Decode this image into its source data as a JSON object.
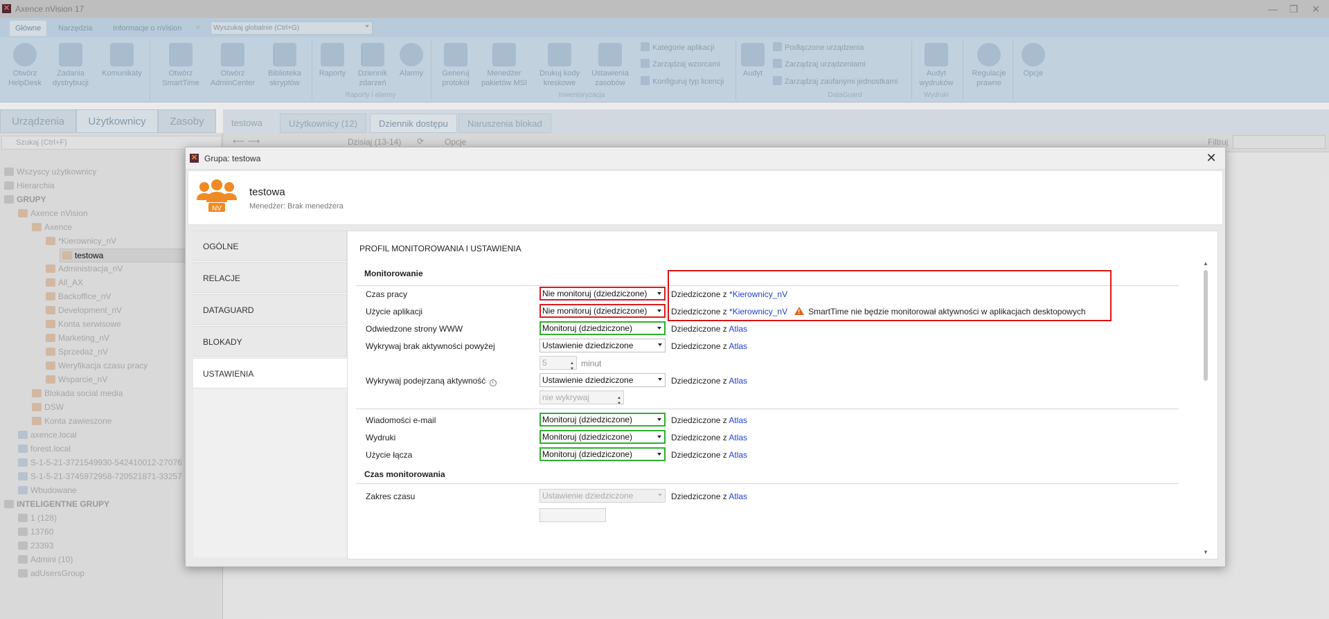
{
  "app": {
    "title": "Axence nVision 17",
    "menu_tabs": [
      "Główne",
      "Narzędzia",
      "Informacje o nVision"
    ],
    "global_search_placeholder": "Wyszukaj globalnie (Ctrl+G)"
  },
  "ribbon": {
    "buttons": [
      {
        "label": "Otwórz HelpDesk",
        "icon": "helpdesk-icon"
      },
      {
        "label": "Zadania dystrybucji",
        "icon": "distribution-icon"
      },
      {
        "label": "Komunikaty",
        "icon": "megaphone-icon"
      },
      {
        "label": "Otwórz SmartTime",
        "icon": "smarttime-icon"
      },
      {
        "label": "Otwórz AdminCenter",
        "icon": "admincenter-icon"
      },
      {
        "label": "Biblioteka skryptów",
        "icon": "script-library-icon"
      },
      {
        "label": "Raporty",
        "icon": "reports-icon"
      },
      {
        "label": "Dziennik zdarzeń",
        "icon": "event-log-icon"
      },
      {
        "label": "Alarmy",
        "icon": "alarm-icon"
      },
      {
        "label": "Generuj protokół",
        "icon": "protocol-icon"
      },
      {
        "label": "Menedżer pakietów MSI",
        "icon": "msi-icon"
      },
      {
        "label": "Drukuj kody kreskowe",
        "icon": "barcode-printer-icon"
      },
      {
        "label": "Ustawienia zasobów",
        "icon": "assets-settings-icon"
      },
      {
        "label": "Audyt",
        "icon": "audit-icon"
      },
      {
        "label": "Audyt wydruków",
        "icon": "print-audit-icon"
      },
      {
        "label": "Regulacje prawne",
        "icon": "legal-icon"
      },
      {
        "label": "Opcje",
        "icon": "gear-icon"
      }
    ],
    "small_buttons": [
      "Kategorie aplikacji",
      "Zarządzaj wzorcami",
      "Konfiguruj typ licencji",
      "Podłączone urządzenia",
      "Zarządzaj urządzeniami",
      "Zarządzaj zaufanymi jednostkami"
    ],
    "group_labels": [
      "Raporty i alarmy",
      "Inwentaryzacja",
      "DataGuard",
      "Wydruki"
    ]
  },
  "left_tabs": [
    "Urządzenia",
    "Użytkownicy",
    "Zasoby"
  ],
  "left_search_placeholder": "Szukaj (Ctrl+F)",
  "tree": [
    "Wszyscy użytkownicy",
    "Hierarchia",
    "GRUPY",
    "Axence nVision",
    "Axence",
    "*Kierownicy_nV",
    "testowa",
    "Administracja_nV",
    "All_AX",
    "Backoffice_nV",
    "Development_nV",
    "Konta serwisowe",
    "Marketing_nV",
    "Sprzedaż_nV",
    "Weryfikacja czasu pracy",
    "Wsparcie_nV",
    "Blokada social media",
    "DSW",
    "Konta zawieszone",
    "axence.local",
    "forest.local",
    "S-1-5-21-3721549930-542410012-27076",
    "S-1-5-21-3745972958-720521871-33257",
    "Wbudowane",
    "INTELIGENTNE GRUPY",
    "1 (128)",
    "13760",
    "23393",
    "Admini (10)",
    "adUsersGroup"
  ],
  "right_tabs": [
    "testowa",
    "Użytkownicy (12)",
    "Dziennik dostępu",
    "Naruszenia blokad"
  ],
  "toolbar": {
    "date": "Dzisiaj (13-14)",
    "options": "Opcje",
    "filter": "Filtruj"
  },
  "dialog": {
    "title": "Grupa: testowa",
    "group_name": "testowa",
    "avatar_badge": "NV",
    "manager": "Menedżer:  Brak menedżera",
    "nav": [
      "OGÓLNE",
      "RELACJE",
      "DATAGUARD",
      "BLOKADY",
      "USTAWIENIA"
    ],
    "section_title": "PROFIL MONITOROWANIA I USTAWIENIA",
    "monitoring_header": "Monitorowanie",
    "time_header": "Czas monitorowania",
    "rows": [
      {
        "label": "Czas pracy",
        "value": "Nie monitoruj (dziedziczone)",
        "inherited_prefix": "Dziedziczone z",
        "source": "*Kierownicy_nV"
      },
      {
        "label": "Użycie aplikacji",
        "value": "Nie monitoruj (dziedziczone)",
        "inherited_prefix": "Dziedziczone z",
        "source": "*Kierownicy_nV",
        "warning": "SmartTime nie będzie monitorował aktywności w aplikacjach desktopowych"
      },
      {
        "label": "Odwiedzone strony WWW",
        "value": "Monitoruj (dziedziczone)",
        "inherited_prefix": "Dziedziczone z",
        "source": "Atlas"
      },
      {
        "label": "Wykrywaj brak aktywności powyżej",
        "value": "Ustawienie dziedziczone",
        "inherited_prefix": "Dziedziczone z",
        "source": "Atlas"
      },
      {
        "label": "Wykrywaj podejrzaną aktywność",
        "value": "Ustawienie dziedziczone",
        "inherited_prefix": "Dziedziczone z",
        "source": "Atlas"
      },
      {
        "label": "Wiadomości e-mail",
        "value": "Monitoruj (dziedziczone)",
        "inherited_prefix": "Dziedziczone z",
        "source": "Atlas"
      },
      {
        "label": "Wydruki",
        "value": "Monitoruj (dziedziczone)",
        "inherited_prefix": "Dziedziczone z",
        "source": "Atlas"
      },
      {
        "label": "Użycie łącza",
        "value": "Monitoruj (dziedziczone)",
        "inherited_prefix": "Dziedziczone z",
        "source": "Atlas"
      },
      {
        "label": "Zakres czasu",
        "value": "Ustawienie dziedziczone",
        "inherited_prefix": "Dziedziczone z",
        "source": "Atlas"
      }
    ],
    "inactivity_minutes": "5",
    "minutes_unit": "minut",
    "suspicious_value": "nie wykrywaj"
  },
  "colors": {
    "highlight_red": "#d91414",
    "highlight_green": "#2bb02b",
    "link": "#1f3fd6",
    "warning": "#e2621d",
    "avatar": "#f08a24"
  }
}
